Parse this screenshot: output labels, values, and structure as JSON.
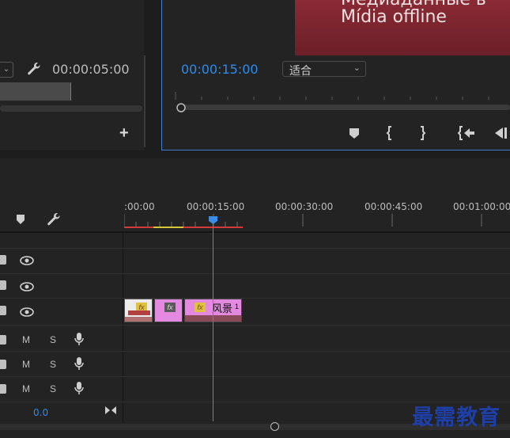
{
  "source_monitor": {
    "timecode": "00:00:05:00"
  },
  "program_monitor": {
    "timecode": "00:00:15:00",
    "fit_select": "适合",
    "offline_line1": "Медиаданные в",
    "offline_line2": "Mídia offline"
  },
  "timeline": {
    "ruler_labels": [
      ":00:00",
      "00:00:15:00",
      "00:00:30:00",
      "00:00:45:00",
      "00:01:00:00"
    ],
    "clip_label": "风景",
    "clip_badge": "1",
    "fx": "fx",
    "audio_m": "M",
    "audio_s": "S",
    "volume": "0.0"
  },
  "watermark": "最需教育",
  "colors": {
    "accent": "#2d8ceb",
    "clip_pink": "#e38ae0",
    "offline_red": "#8a2a35"
  }
}
